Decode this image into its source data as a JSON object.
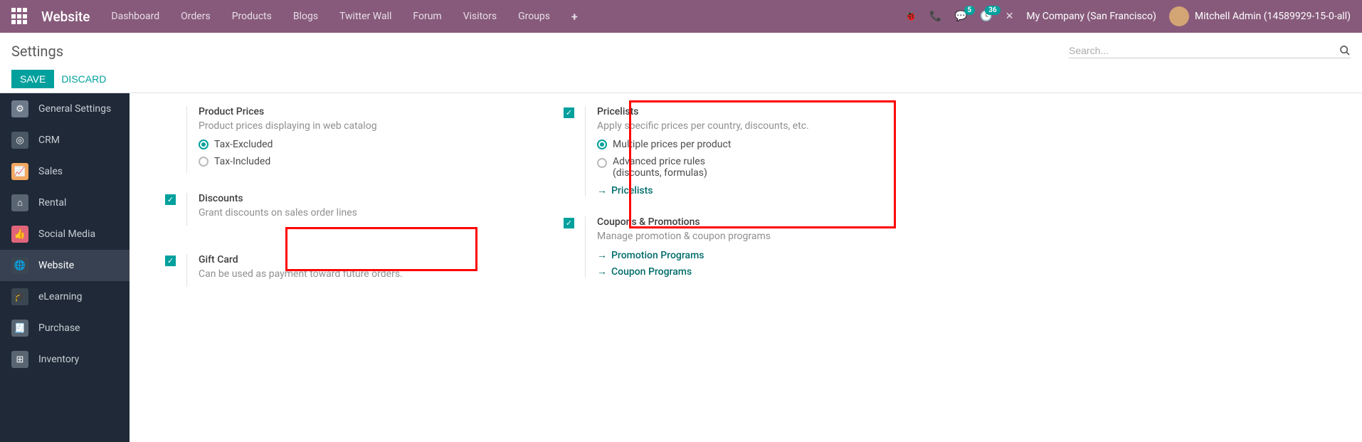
{
  "topnav": {
    "brand": "Website",
    "items": [
      "Dashboard",
      "Orders",
      "Products",
      "Blogs",
      "Twitter Wall",
      "Forum",
      "Visitors",
      "Groups"
    ],
    "conversations_badge": "5",
    "activities_badge": "36",
    "company": "My Company (San Francisco)",
    "user": "Mitchell Admin (14589929-15-0-all)"
  },
  "header": {
    "title": "Settings",
    "search_placeholder": "Search...",
    "save": "SAVE",
    "discard": "DISCARD"
  },
  "sidebar": {
    "items": [
      {
        "label": "General Settings",
        "color": "#6d7a89",
        "glyph": "⚙"
      },
      {
        "label": "CRM",
        "color": "#4a5864",
        "glyph": "◎"
      },
      {
        "label": "Sales",
        "color": "#f0a860",
        "glyph": "📈"
      },
      {
        "label": "Rental",
        "color": "#5a6572",
        "glyph": "⌂"
      },
      {
        "label": "Social Media",
        "color": "#e0647a",
        "glyph": "👍"
      },
      {
        "label": "Website",
        "color": "#3a4752",
        "glyph": "🌐"
      },
      {
        "label": "eLearning",
        "color": "#3a4752",
        "glyph": "🎓"
      },
      {
        "label": "Purchase",
        "color": "#5a6572",
        "glyph": "🧾"
      },
      {
        "label": "Inventory",
        "color": "#5a6572",
        "glyph": "⊞"
      }
    ],
    "active_index": 5
  },
  "settings": {
    "left": [
      {
        "title": "Product Prices",
        "desc": "Product prices displaying in web catalog",
        "has_check": false,
        "radios": [
          {
            "label": "Tax-Excluded",
            "checked": true
          },
          {
            "label": "Tax-Included",
            "checked": false
          }
        ]
      },
      {
        "title": "Discounts",
        "desc": "Grant discounts on sales order lines",
        "has_check": true
      },
      {
        "title": "Gift Card",
        "desc": "Can be used as payment toward future orders.",
        "has_check": true
      }
    ],
    "right": [
      {
        "title": "Pricelists",
        "desc": "Apply specific prices per country, discounts, etc.",
        "has_check": true,
        "radios": [
          {
            "label": "Multiple prices per product",
            "checked": true
          },
          {
            "label": "Advanced price rules (discounts, formulas)",
            "checked": false
          }
        ],
        "links": [
          "Pricelists"
        ]
      },
      {
        "title": "Coupons & Promotions",
        "desc": "Manage promotion & coupon programs",
        "has_check": true,
        "links": [
          "Promotion Programs",
          "Coupon Programs"
        ]
      }
    ]
  }
}
